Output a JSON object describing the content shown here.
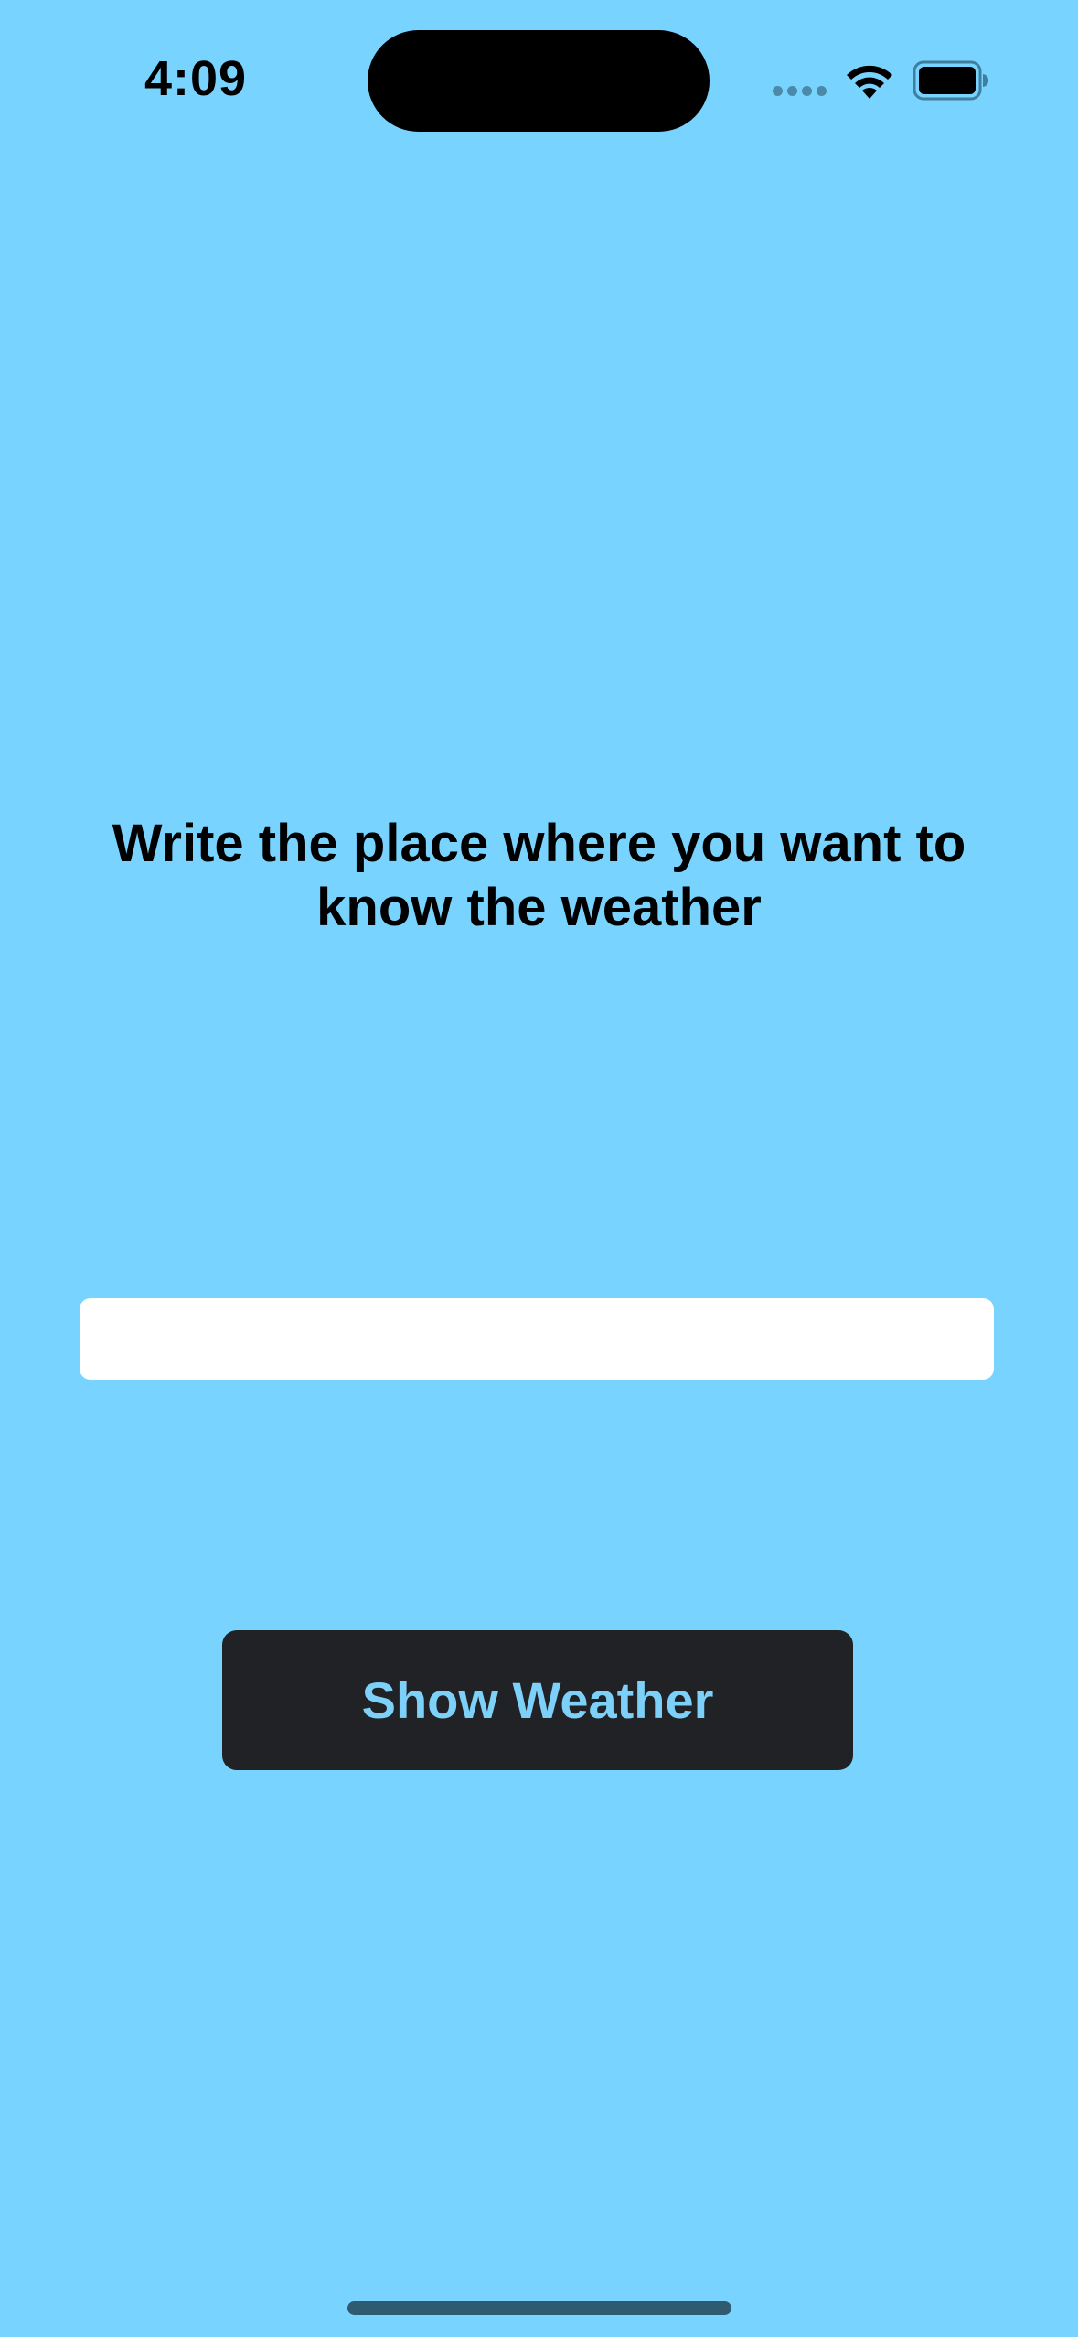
{
  "status_bar": {
    "time": "4:09",
    "signal_icon": "cellular-signal-dots-icon",
    "wifi_icon": "wifi-icon",
    "battery_icon": "battery-full-icon"
  },
  "main": {
    "heading": "Write the place where you want to know the weather",
    "place_input": {
      "value": "",
      "placeholder": ""
    },
    "show_weather_button": "Show Weather"
  },
  "colors": {
    "background": "#78D4FE",
    "button_background": "#202225",
    "button_text": "#7DD0F8",
    "input_background": "#FFFFFF"
  }
}
